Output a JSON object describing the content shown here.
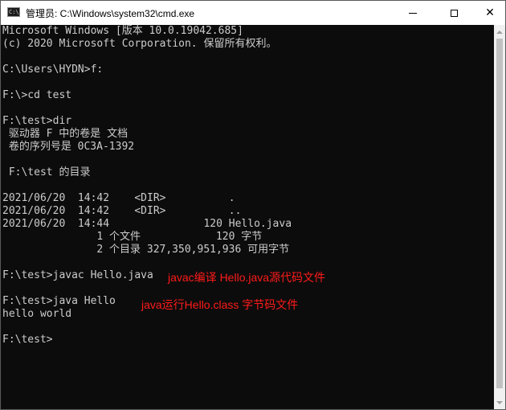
{
  "window": {
    "title": "管理员: C:\\Windows\\system32\\cmd.exe",
    "icon": "cmd-icon",
    "icon_text": "C:\\_",
    "minimize_glyph": "minimize-icon",
    "maximize_glyph": "maximize-icon",
    "close_glyph": "✕"
  },
  "console": {
    "lines": [
      "Microsoft Windows [版本 10.0.19042.685]",
      "(c) 2020 Microsoft Corporation. 保留所有权利。",
      "",
      "C:\\Users\\HYDN>f:",
      "",
      "F:\\>cd test",
      "",
      "F:\\test>dir",
      " 驱动器 F 中的卷是 文档",
      " 卷的序列号是 0C3A-1392",
      "",
      " F:\\test 的目录",
      "",
      "2021/06/20  14:42    <DIR>          .",
      "2021/06/20  14:42    <DIR>          ..",
      "2021/06/20  14:44               120 Hello.java",
      "               1 个文件            120 字节",
      "               2 个目录 327,350,951,936 可用字节",
      "",
      "F:\\test>javac Hello.java",
      "",
      "F:\\test>java Hello",
      "hello world",
      "",
      "F:\\test>"
    ]
  },
  "annotations": [
    {
      "text": "javac编译 Hello.java源代码文件",
      "color": "#ff1a1a"
    },
    {
      "text": "java运行Hello.class 字节码文件",
      "color": "#ff1a1a"
    }
  ],
  "colors": {
    "console_bg": "#0c0c0c",
    "console_text": "#cccccc",
    "annotation": "#ff1a1a",
    "titlebar_bg": "#ffffff"
  }
}
